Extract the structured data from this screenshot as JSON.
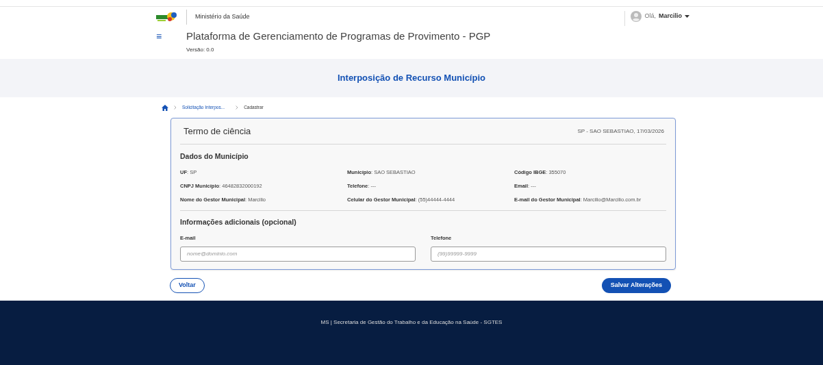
{
  "header": {
    "ministry": "Ministério da Saúde",
    "title": "Plataforma de Gerenciamento de Programas de Provimento - PGP",
    "version": "Versão: 0.0",
    "menu_icon": "≡",
    "user": {
      "greeting": "Olá,",
      "name": "Marcilio"
    }
  },
  "page_title": "Interposição de Recurso Município",
  "breadcrumb": [
    {
      "label": "Solicitação Interpos..."
    },
    {
      "label": "Cadastrar"
    }
  ],
  "card": {
    "title": "Termo de ciência",
    "place_date": "SP - SAO SEBASTIAO, 17/03/2026",
    "section_1": "Dados do Município",
    "fields": [
      {
        "text": "**UF**: SP"
      },
      {
        "text": "**Município**: SAO SEBASTIAO"
      },
      {
        "text": "**Código IBGE**: 355070"
      },
      {
        "text": "**CNPJ Município**: 46482832000192"
      },
      {
        "text": "**Telefone**: ---"
      },
      {
        "text": "**Email**: ---"
      },
      {
        "text": "**Nome do Gestor Municipal**: Marcilio"
      },
      {
        "text": "**Celular do Gestor Municipal**: (55)44444-4444"
      },
      {
        "text": "**E-mail do Gestor Municipal**: Marcilio@Marcilio.com.br"
      }
    ],
    "section_2": "Informações adicionais (opcional)",
    "inputs": [
      {
        "label": "E-mail",
        "placeholder": "nome@dominio.com"
      },
      {
        "label": "Telefone",
        "placeholder": "(99)99999-9999"
      }
    ]
  },
  "buttons": {
    "back": "Voltar",
    "save": "Salvar Alterações"
  },
  "footer": "MS | Secretaria de Gestão do Trabalho e da Educação na Saúde - SGTES"
}
